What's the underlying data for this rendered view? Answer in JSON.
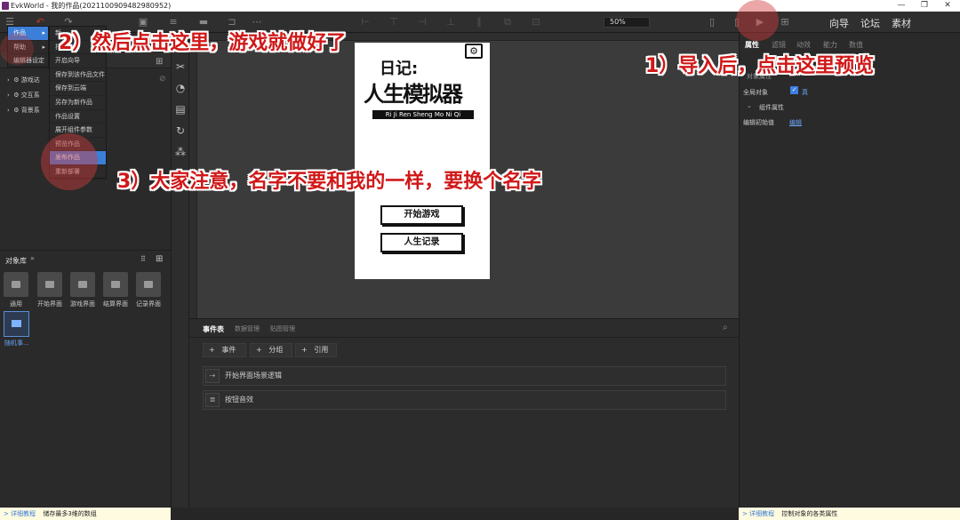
{
  "window": {
    "title": "EvkWorld - 我的作品(20211009094829809​52)",
    "controls": [
      "—",
      "❐",
      "✕"
    ]
  },
  "topbar": {
    "zoom": "50%",
    "links": [
      "向导",
      "论坛",
      "素材"
    ]
  },
  "menu": {
    "main": [
      "作品",
      "帮助",
      "编辑器设定"
    ],
    "sub": [
      "新",
      "打",
      "开启向导",
      "保存到该作品文件",
      "保存到云端",
      "另存为新作品",
      "作品设置",
      "展开组件参数",
      "预览作品",
      "发布作品",
      "重新部署"
    ]
  },
  "left": {
    "tree": [
      "游戏达",
      "交互系",
      "背景系"
    ],
    "library_title": "对象库",
    "objects": [
      "通用",
      "开始界面",
      "游戏界面",
      "结算界面",
      "记录界面"
    ],
    "random_obj": "随机事..."
  },
  "canvas": {
    "title1": "日记:",
    "title2": "人生模拟器",
    "subtitle": "Ri Ji Ren Sheng Mo Ni Qi",
    "buttons": [
      "开始游戏",
      "人生记录"
    ]
  },
  "events": {
    "tabs": [
      "事件表",
      "数据管理",
      "贴图管理"
    ],
    "actions": [
      "事件",
      "分组",
      "引用"
    ],
    "rows": [
      "开始界面场景逻辑",
      "按钮音效"
    ]
  },
  "right": {
    "tabs": [
      "属性",
      "滤镜",
      "动效",
      "能力",
      "数值"
    ],
    "obj_label": "[对",
    "props_header": "对象属性",
    "global_label": "全局对象",
    "global_value": "真",
    "component_props": "组件属性",
    "edit_init_label": "编辑初始值",
    "edit_init_value": "编辑"
  },
  "annotations": {
    "a1": "1）导入后，点击这里预览",
    "a2": "2）然后点击这里，游戏就做好了",
    "a3": "3）大家注意，名字不要和我的一样，要换个名字"
  },
  "status": {
    "left_link": "> 详细教程",
    "left_text": "储存最多3维的数组",
    "right_link": "> 详细教程",
    "right_text": "控制对象的各类属性"
  }
}
